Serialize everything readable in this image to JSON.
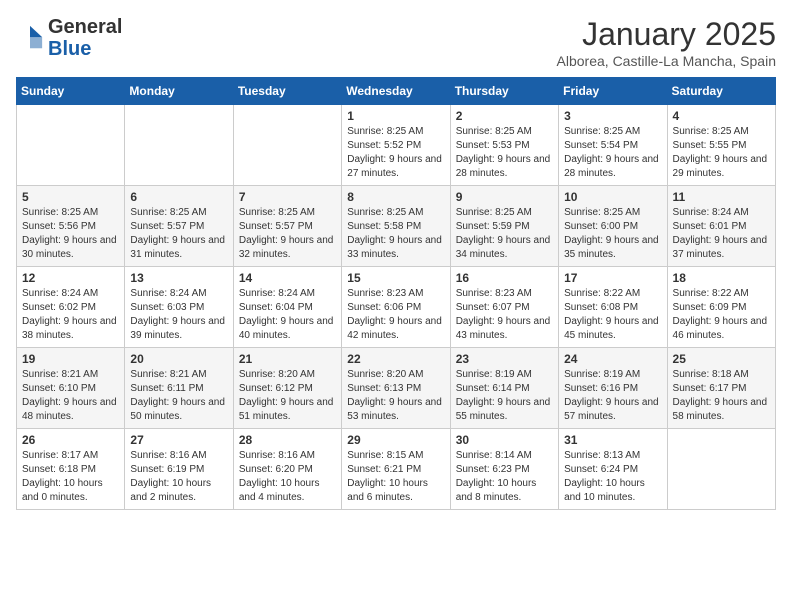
{
  "header": {
    "logo": {
      "general": "General",
      "blue": "Blue"
    },
    "title": "January 2025",
    "location": "Alborea, Castille-La Mancha, Spain"
  },
  "weekdays": [
    "Sunday",
    "Monday",
    "Tuesday",
    "Wednesday",
    "Thursday",
    "Friday",
    "Saturday"
  ],
  "weeks": [
    [
      {
        "day": "",
        "info": ""
      },
      {
        "day": "",
        "info": ""
      },
      {
        "day": "",
        "info": ""
      },
      {
        "day": "1",
        "info": "Sunrise: 8:25 AM\nSunset: 5:52 PM\nDaylight: 9 hours and 27 minutes."
      },
      {
        "day": "2",
        "info": "Sunrise: 8:25 AM\nSunset: 5:53 PM\nDaylight: 9 hours and 28 minutes."
      },
      {
        "day": "3",
        "info": "Sunrise: 8:25 AM\nSunset: 5:54 PM\nDaylight: 9 hours and 28 minutes."
      },
      {
        "day": "4",
        "info": "Sunrise: 8:25 AM\nSunset: 5:55 PM\nDaylight: 9 hours and 29 minutes."
      }
    ],
    [
      {
        "day": "5",
        "info": "Sunrise: 8:25 AM\nSunset: 5:56 PM\nDaylight: 9 hours and 30 minutes."
      },
      {
        "day": "6",
        "info": "Sunrise: 8:25 AM\nSunset: 5:57 PM\nDaylight: 9 hours and 31 minutes."
      },
      {
        "day": "7",
        "info": "Sunrise: 8:25 AM\nSunset: 5:57 PM\nDaylight: 9 hours and 32 minutes."
      },
      {
        "day": "8",
        "info": "Sunrise: 8:25 AM\nSunset: 5:58 PM\nDaylight: 9 hours and 33 minutes."
      },
      {
        "day": "9",
        "info": "Sunrise: 8:25 AM\nSunset: 5:59 PM\nDaylight: 9 hours and 34 minutes."
      },
      {
        "day": "10",
        "info": "Sunrise: 8:25 AM\nSunset: 6:00 PM\nDaylight: 9 hours and 35 minutes."
      },
      {
        "day": "11",
        "info": "Sunrise: 8:24 AM\nSunset: 6:01 PM\nDaylight: 9 hours and 37 minutes."
      }
    ],
    [
      {
        "day": "12",
        "info": "Sunrise: 8:24 AM\nSunset: 6:02 PM\nDaylight: 9 hours and 38 minutes."
      },
      {
        "day": "13",
        "info": "Sunrise: 8:24 AM\nSunset: 6:03 PM\nDaylight: 9 hours and 39 minutes."
      },
      {
        "day": "14",
        "info": "Sunrise: 8:24 AM\nSunset: 6:04 PM\nDaylight: 9 hours and 40 minutes."
      },
      {
        "day": "15",
        "info": "Sunrise: 8:23 AM\nSunset: 6:06 PM\nDaylight: 9 hours and 42 minutes."
      },
      {
        "day": "16",
        "info": "Sunrise: 8:23 AM\nSunset: 6:07 PM\nDaylight: 9 hours and 43 minutes."
      },
      {
        "day": "17",
        "info": "Sunrise: 8:22 AM\nSunset: 6:08 PM\nDaylight: 9 hours and 45 minutes."
      },
      {
        "day": "18",
        "info": "Sunrise: 8:22 AM\nSunset: 6:09 PM\nDaylight: 9 hours and 46 minutes."
      }
    ],
    [
      {
        "day": "19",
        "info": "Sunrise: 8:21 AM\nSunset: 6:10 PM\nDaylight: 9 hours and 48 minutes."
      },
      {
        "day": "20",
        "info": "Sunrise: 8:21 AM\nSunset: 6:11 PM\nDaylight: 9 hours and 50 minutes."
      },
      {
        "day": "21",
        "info": "Sunrise: 8:20 AM\nSunset: 6:12 PM\nDaylight: 9 hours and 51 minutes."
      },
      {
        "day": "22",
        "info": "Sunrise: 8:20 AM\nSunset: 6:13 PM\nDaylight: 9 hours and 53 minutes."
      },
      {
        "day": "23",
        "info": "Sunrise: 8:19 AM\nSunset: 6:14 PM\nDaylight: 9 hours and 55 minutes."
      },
      {
        "day": "24",
        "info": "Sunrise: 8:19 AM\nSunset: 6:16 PM\nDaylight: 9 hours and 57 minutes."
      },
      {
        "day": "25",
        "info": "Sunrise: 8:18 AM\nSunset: 6:17 PM\nDaylight: 9 hours and 58 minutes."
      }
    ],
    [
      {
        "day": "26",
        "info": "Sunrise: 8:17 AM\nSunset: 6:18 PM\nDaylight: 10 hours and 0 minutes."
      },
      {
        "day": "27",
        "info": "Sunrise: 8:16 AM\nSunset: 6:19 PM\nDaylight: 10 hours and 2 minutes."
      },
      {
        "day": "28",
        "info": "Sunrise: 8:16 AM\nSunset: 6:20 PM\nDaylight: 10 hours and 4 minutes."
      },
      {
        "day": "29",
        "info": "Sunrise: 8:15 AM\nSunset: 6:21 PM\nDaylight: 10 hours and 6 minutes."
      },
      {
        "day": "30",
        "info": "Sunrise: 8:14 AM\nSunset: 6:23 PM\nDaylight: 10 hours and 8 minutes."
      },
      {
        "day": "31",
        "info": "Sunrise: 8:13 AM\nSunset: 6:24 PM\nDaylight: 10 hours and 10 minutes."
      },
      {
        "day": "",
        "info": ""
      }
    ]
  ]
}
